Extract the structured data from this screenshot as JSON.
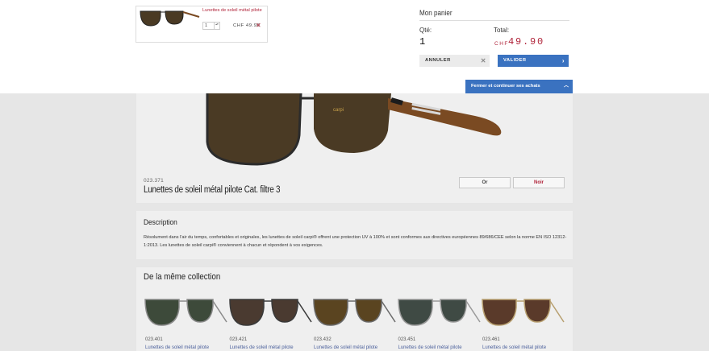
{
  "cart": {
    "title": "Mon panier",
    "item": {
      "name": "Lunettes de soleil métal pilote",
      "quantity": "1",
      "stepper": "▴▾",
      "price": "CHF 49.90",
      "remove_symbol": "✕"
    },
    "qty_label": "Qté:",
    "qty_value": "1",
    "total_label": "Total:",
    "total_currency": "CHF",
    "total_amount": "49.90",
    "cancel_label": "ANNULER",
    "cancel_symbol": "✕",
    "validate_label": "VALIDER",
    "validate_symbol": "›",
    "continue_label": "Fermer et continuer ses achats",
    "continue_symbol": "︿"
  },
  "product": {
    "code": "023.371",
    "title": "Lunettes de soleil métal pilote Cat. filtre 3",
    "variants": [
      "Or",
      "Noir"
    ],
    "selected_variant": "Noir"
  },
  "description": {
    "heading": "Description",
    "text": "Résolument dans l'air du temps, confortables et originales, les lunettes de soleil carpi® offrent une protection UV à 100% et sont conformes aux directives européennes 89/686/CEE selon la norme EN ISO 12312-1:2013. Les lunettes de soleil carpi® conviennent à chacun et répondent à vos exigences."
  },
  "collection": {
    "heading": "De la même collection",
    "items": [
      {
        "code": "023.401",
        "name": "Lunettes de soleil métal pilote",
        "lens": "#3d4a3a",
        "frame": "#8a8a8a"
      },
      {
        "code": "023.421",
        "name": "Lunettes de soleil métal pilote",
        "lens": "#4a3a30",
        "frame": "#3a3a3a"
      },
      {
        "code": "023.432",
        "name": "Lunettes de soleil métal pilote",
        "lens": "#5a4420",
        "frame": "#6a6a6a"
      },
      {
        "code": "023.451",
        "name": "Lunettes de soleil métal pilote",
        "lens": "#3f4a44",
        "frame": "#9a9a9a"
      },
      {
        "code": "023.461",
        "name": "Lunettes de soleil métal pilote",
        "lens": "#5a3a2a",
        "frame": "#b8a070"
      }
    ]
  },
  "colors": {
    "accent": "#3a72c0",
    "brand_red": "#b0243a"
  }
}
